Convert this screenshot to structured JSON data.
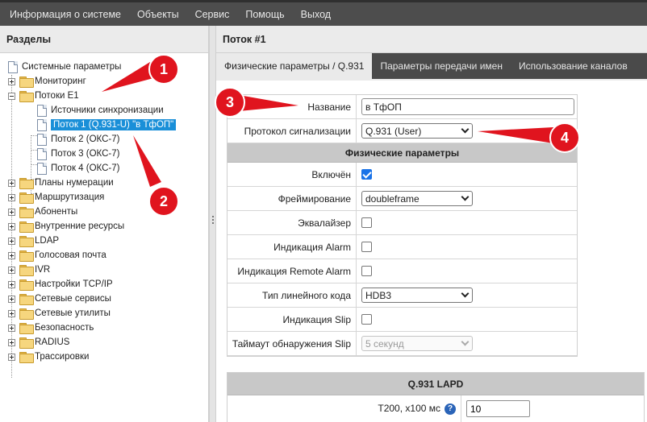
{
  "menu": {
    "items": [
      "Информация о системе",
      "Объекты",
      "Сервис",
      "Помощь",
      "Выход"
    ]
  },
  "left": {
    "title": "Разделы",
    "tree": {
      "system": "Системные параметры",
      "monitoring": "Мониторинг",
      "e1": "Потоки Е1",
      "e1_children": [
        "Источники синхронизации",
        "Поток 1 (Q.931-U) \"в ТфОП\"",
        "Поток 2 (ОКС-7)",
        "Поток 3 (ОКС-7)",
        "Поток 4 (ОКС-7)"
      ],
      "rest": [
        "Планы нумерации",
        "Маршрутизация",
        "Абоненты",
        "Внутренние ресурсы",
        "LDAP",
        "Голосовая почта",
        "IVR",
        "Настройки TCP/IP",
        "Сетевые сервисы",
        "Сетевые утилиты",
        "Безопасность",
        "RADIUS",
        "Трассировки"
      ]
    }
  },
  "right": {
    "title": "Поток #1",
    "tabs": [
      "Физические параметры / Q.931",
      "Параметры передачи имен",
      "Использование каналов"
    ],
    "form": {
      "name_label": "Название",
      "name_value": "в ТфОП",
      "protocol_label": "Протокол сигнализации",
      "protocol_value": "Q.931 (User)",
      "phys_section": "Физические параметры",
      "enabled_label": "Включён",
      "enabled": true,
      "framing_label": "Фреймирование",
      "framing_value": "doubleframe",
      "equalizer_label": "Эквалайзер",
      "equalizer": false,
      "alarm_label": "Индикация Alarm",
      "alarm": false,
      "remote_alarm_label": "Индикация Remote Alarm",
      "remote_alarm": false,
      "line_code_label": "Тип линейного кода",
      "line_code_value": "HDB3",
      "slip_label": "Индикация Slip",
      "slip": false,
      "slip_timeout_label": "Таймаут обнаружения Slip",
      "slip_timeout_value": "5 секунд"
    },
    "lapd": {
      "section": "Q.931 LAPD",
      "t200_label": "T200, x100 мс",
      "t200_value": "10",
      "help_glyph": "?"
    }
  },
  "annotations": {
    "color": "#e0141e",
    "badges": [
      "1",
      "2",
      "3",
      "4"
    ]
  }
}
